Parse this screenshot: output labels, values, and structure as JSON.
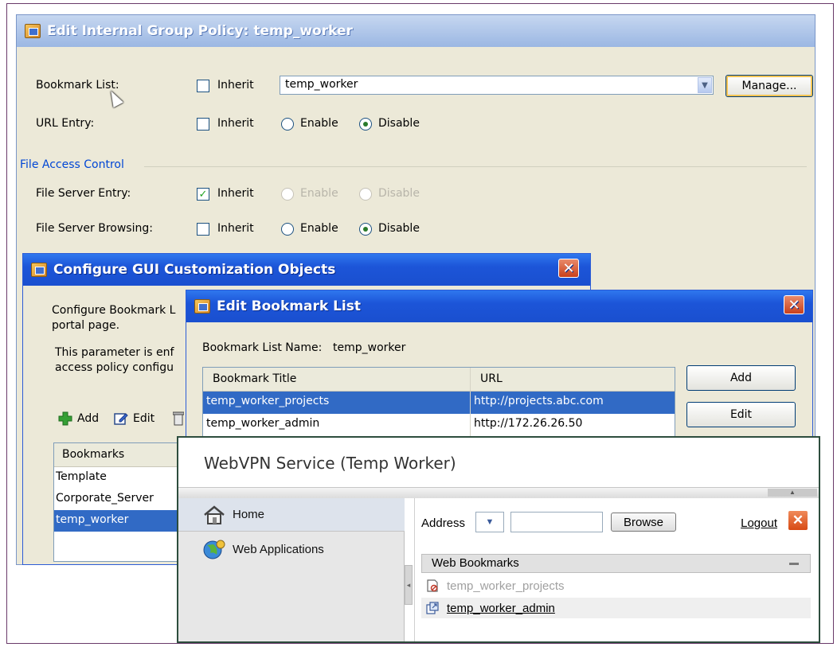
{
  "group_policy": {
    "title": "Edit Internal Group Policy: temp_worker",
    "bookmark_list_label": "Bookmark List:",
    "inherit_label": "Inherit",
    "bookmark_list_value": "temp_worker",
    "manage_label": "Manage...",
    "url_entry_label": "URL Entry:",
    "enable_label": "Enable",
    "disable_label": "Disable",
    "file_access_section": "File Access Control",
    "file_server_entry_label": "File Server Entry:",
    "file_server_browsing_label": "File Server Browsing:"
  },
  "gui_custom": {
    "title": "Configure GUI Customization Objects",
    "desc1_line1": "Configure Bookmark L",
    "desc1_line2": "portal page.",
    "desc2_line1": "This parameter is enf",
    "desc2_line2": "access policy configu",
    "add_label": "Add",
    "edit_label": "Edit",
    "bookmarks_header": "Bookmarks",
    "bookmarks": [
      "Template",
      "Corporate_Server",
      "temp_worker"
    ]
  },
  "bookmark_list": {
    "title": "Edit Bookmark List",
    "name_label": "Bookmark List Name:",
    "name_value": "temp_worker",
    "col_title": "Bookmark Title",
    "col_url": "URL",
    "rows": [
      {
        "title": "temp_worker_projects",
        "url": "http://projects.abc.com"
      },
      {
        "title": "temp_worker_admin",
        "url": "http://172.26.26.50"
      }
    ],
    "add_button": "Add",
    "edit_button": "Edit"
  },
  "webvpn": {
    "title": "WebVPN Service (Temp Worker)",
    "nav_home": "Home",
    "nav_webapps": "Web Applications",
    "address_label": "Address",
    "browse_label": "Browse",
    "logout_label": "Logout",
    "web_bookmarks_header": "Web Bookmarks",
    "bookmarks": [
      "temp_worker_projects",
      "temp_worker_admin"
    ]
  }
}
